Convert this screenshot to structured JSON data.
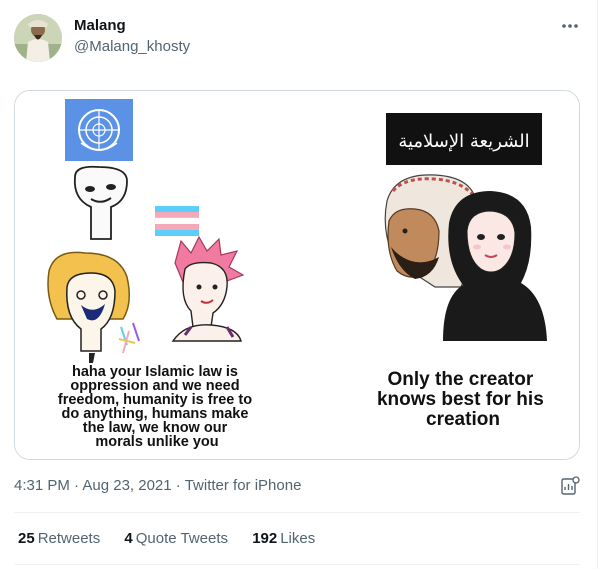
{
  "author": {
    "name": "Malang",
    "handle": "@Malang_khosty"
  },
  "tweet": {
    "timestamp": "4:31 PM · Aug 23, 2021",
    "separator": " · ",
    "source": "Twitter for iPhone"
  },
  "meme": {
    "left_caption": [
      "haha your Islamic law is",
      "oppression and we need",
      "freedom, humanity is free to",
      "do anything, humans make",
      "the law, we know our",
      "morals unlike you"
    ],
    "right_caption": [
      "Only the creator",
      "knows best for his",
      "creation"
    ],
    "banner_text": "الشريعة الإسلامية",
    "colors": {
      "un_blue": "#5b92e5",
      "trans_blue": "#5bcefa",
      "trans_pink": "#f5a9b8",
      "pink_hair": "#f07aa0",
      "blonde_hair": "#f2c14e"
    }
  },
  "engagement": {
    "retweets_count": "25",
    "retweets_label": "Retweets",
    "quotes_count": "4",
    "quotes_label": "Quote Tweets",
    "likes_count": "192",
    "likes_label": "Likes"
  },
  "icons": [
    "more-icon",
    "analytics-icon"
  ]
}
